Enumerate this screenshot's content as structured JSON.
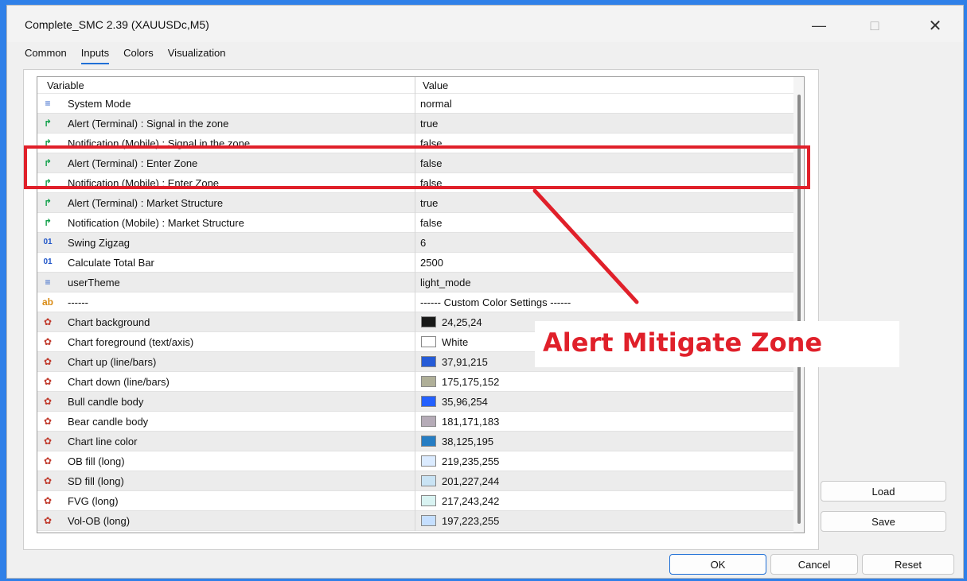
{
  "window": {
    "title": "Complete_SMC 2.39 (XAUUSDc,M5)",
    "minimize": "—",
    "maximize": "□",
    "close": "✕"
  },
  "tabs": [
    {
      "label": "Common",
      "active": false
    },
    {
      "label": "Inputs",
      "active": true
    },
    {
      "label": "Colors",
      "active": false
    },
    {
      "label": "Visualization",
      "active": false
    }
  ],
  "table": {
    "headers": {
      "variable": "Variable",
      "value": "Value"
    },
    "rows": [
      {
        "icon": "list-icon",
        "name": "System Mode",
        "value": "normal"
      },
      {
        "icon": "bool-arrow-icon",
        "name": "Alert (Terminal) : Signal in the zone",
        "value": "true"
      },
      {
        "icon": "bool-arrow-icon",
        "name": "Notification (Mobile) : Signal in the zone",
        "value": "false"
      },
      {
        "icon": "bool-arrow-icon",
        "name": "Alert (Terminal) : Enter Zone",
        "value": "false"
      },
      {
        "icon": "bool-arrow-icon",
        "name": "Notification (Mobile) : Enter Zone",
        "value": "false"
      },
      {
        "icon": "bool-arrow-icon",
        "name": "Alert (Terminal) : Market Structure",
        "value": "true"
      },
      {
        "icon": "bool-arrow-icon",
        "name": "Notification (Mobile) : Market Structure",
        "value": "false"
      },
      {
        "icon": "integer-icon",
        "name": "Swing Zigzag",
        "value": "6"
      },
      {
        "icon": "integer-icon",
        "name": "Calculate Total Bar",
        "value": "2500"
      },
      {
        "icon": "list-icon",
        "name": "userTheme",
        "value": "light_mode"
      },
      {
        "icon": "string-icon",
        "name": "------",
        "value": "------ Custom Color Settings ------"
      },
      {
        "icon": "palette-icon",
        "name": "Chart background",
        "value": "24,25,24",
        "swatch": "#181918"
      },
      {
        "icon": "palette-icon",
        "name": "Chart foreground (text/axis)",
        "value": "White",
        "swatch": "#ffffff"
      },
      {
        "icon": "palette-icon",
        "name": "Chart up (line/bars)",
        "value": "37,91,215",
        "swatch": "#255bd7"
      },
      {
        "icon": "palette-icon",
        "name": "Chart down (line/bars)",
        "value": "175,175,152",
        "swatch": "#afaf98"
      },
      {
        "icon": "palette-icon",
        "name": "Bull candle body",
        "value": "35,96,254",
        "swatch": "#2360fe"
      },
      {
        "icon": "palette-icon",
        "name": "Bear candle body",
        "value": "181,171,183",
        "swatch": "#b5abb7"
      },
      {
        "icon": "palette-icon",
        "name": "Chart line color",
        "value": "38,125,195",
        "swatch": "#267dc3"
      },
      {
        "icon": "palette-icon",
        "name": "OB fill (long)",
        "value": "219,235,255",
        "swatch": "#dbebff"
      },
      {
        "icon": "palette-icon",
        "name": "SD fill (long)",
        "value": "201,227,244",
        "swatch": "#c9e3f4"
      },
      {
        "icon": "palette-icon",
        "name": "FVG (long)",
        "value": "217,243,242",
        "swatch": "#d9f3f2"
      },
      {
        "icon": "palette-icon",
        "name": "Vol-OB (long)",
        "value": "197,223,255",
        "swatch": "#c5dfff"
      }
    ]
  },
  "annotation": {
    "callout": "Alert Mitigate Zone",
    "color": "#e0202a"
  },
  "buttons": {
    "load": "Load",
    "save": "Save",
    "ok": "OK",
    "cancel": "Cancel",
    "reset": "Reset"
  },
  "colors": {
    "accent": "#1f6fd6",
    "highlight": "#e0202a"
  }
}
